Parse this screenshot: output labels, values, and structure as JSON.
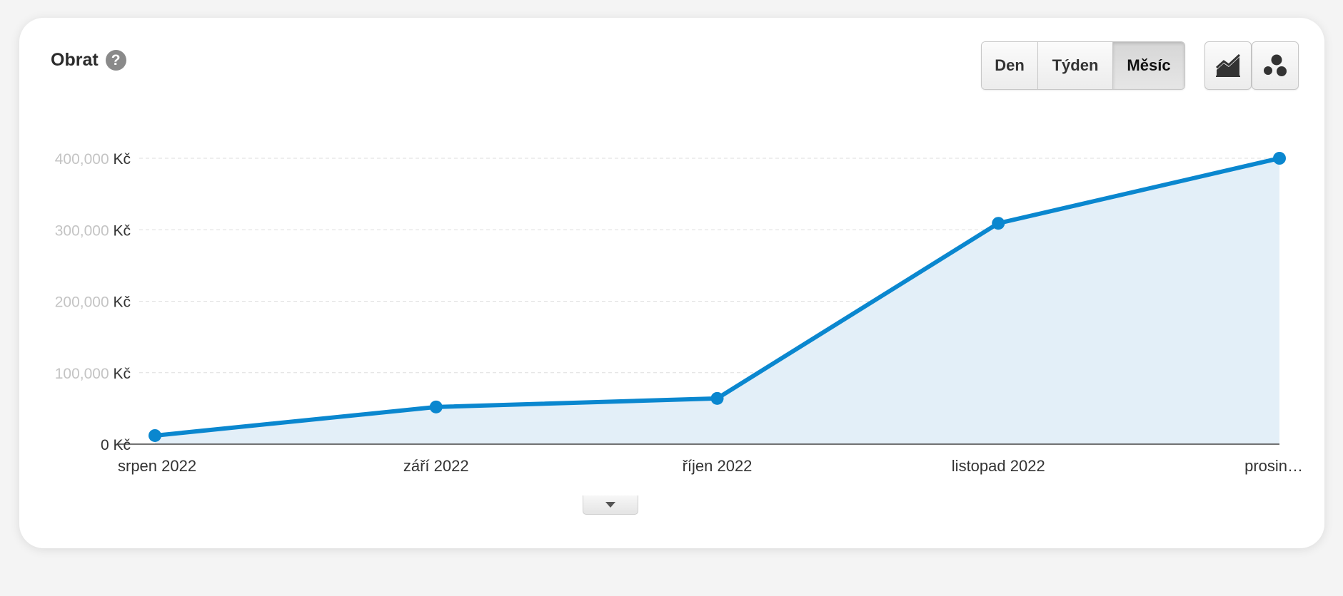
{
  "widget": {
    "title": "Obrat",
    "help_icon": "question-mark-icon",
    "period_buttons": [
      {
        "label": "Den",
        "active": false
      },
      {
        "label": "Týden",
        "active": false
      },
      {
        "label": "Měsíc",
        "active": true
      }
    ],
    "chart_type_buttons": [
      {
        "icon": "line-chart-icon"
      },
      {
        "icon": "bubble-chart-icon"
      }
    ],
    "expand_toggle_icon": "caret-down-icon"
  },
  "colors": {
    "line": "#0a87cf",
    "area_fill": "#e3eff8",
    "gridline": "#dddddd",
    "text": "#333333",
    "blurred_text": "#c4c4c4"
  },
  "chart_data": {
    "type": "area",
    "title": "Obrat",
    "categories": [
      "srpen 2022",
      "září 2022",
      "říjen 2022",
      "listopad 2022",
      "prosin…"
    ],
    "series": [
      {
        "values": [
          12000,
          52000,
          64000,
          309000,
          400000
        ]
      }
    ],
    "y_unit": "Kč",
    "ylim": [
      0,
      400000
    ],
    "y_ticks": [
      {
        "value": 0,
        "label": "0 Kč"
      },
      {
        "value": 100000,
        "label": "100,000 Kč"
      },
      {
        "value": 200000,
        "label": "200,000 Kč"
      },
      {
        "value": 300000,
        "label": "300,000 Kč"
      },
      {
        "value": 400000,
        "label": "400,000 Kč"
      }
    ],
    "grid": true,
    "legend": "none"
  }
}
